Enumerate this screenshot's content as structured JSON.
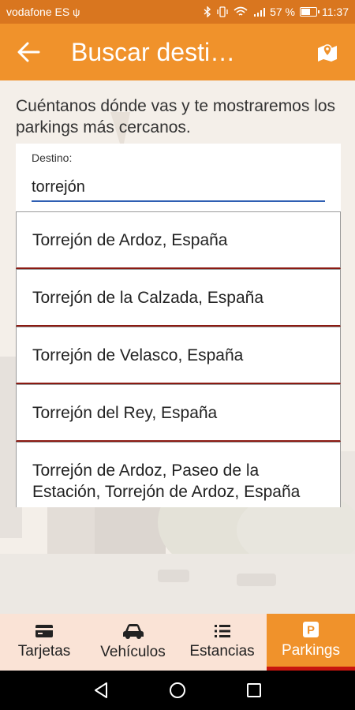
{
  "status_bar": {
    "carrier": "vodafone ES",
    "usb_symbol": "ψ",
    "battery_percent": "57 %",
    "battery_level": 0.57,
    "time": "11:37"
  },
  "app_bar": {
    "title": "Buscar desti…"
  },
  "intro_text": "Cuéntanos dónde vas y te mostraremos los parkings más cercanos.",
  "destination": {
    "label": "Destino:",
    "value": "torrejón"
  },
  "suggestions": [
    "Torrejón de Ardoz, España",
    "Torrejón de la Calzada, España",
    "Torrejón de Velasco, España",
    "Torrejón del Rey, España",
    "Torrejón de Ardoz, Paseo de la Estación, Torrejón de Ardoz, España"
  ],
  "bottom_nav": {
    "tabs": [
      {
        "label": "Tarjetas",
        "icon": "credit-card-icon"
      },
      {
        "label": "Vehículos",
        "icon": "car-icon"
      },
      {
        "label": "Estancias",
        "icon": "list-icon"
      },
      {
        "label": "Parkings",
        "icon": "parking-icon"
      }
    ],
    "active_index": 3
  },
  "colors": {
    "status_bar": "#d9761f",
    "app_bar": "#f0922b",
    "input_underline": "#2f5fb3",
    "suggestion_divider": "#8b1a12",
    "nav_inactive": "#fae3d6",
    "nav_active_indicator": "#c8150e"
  }
}
